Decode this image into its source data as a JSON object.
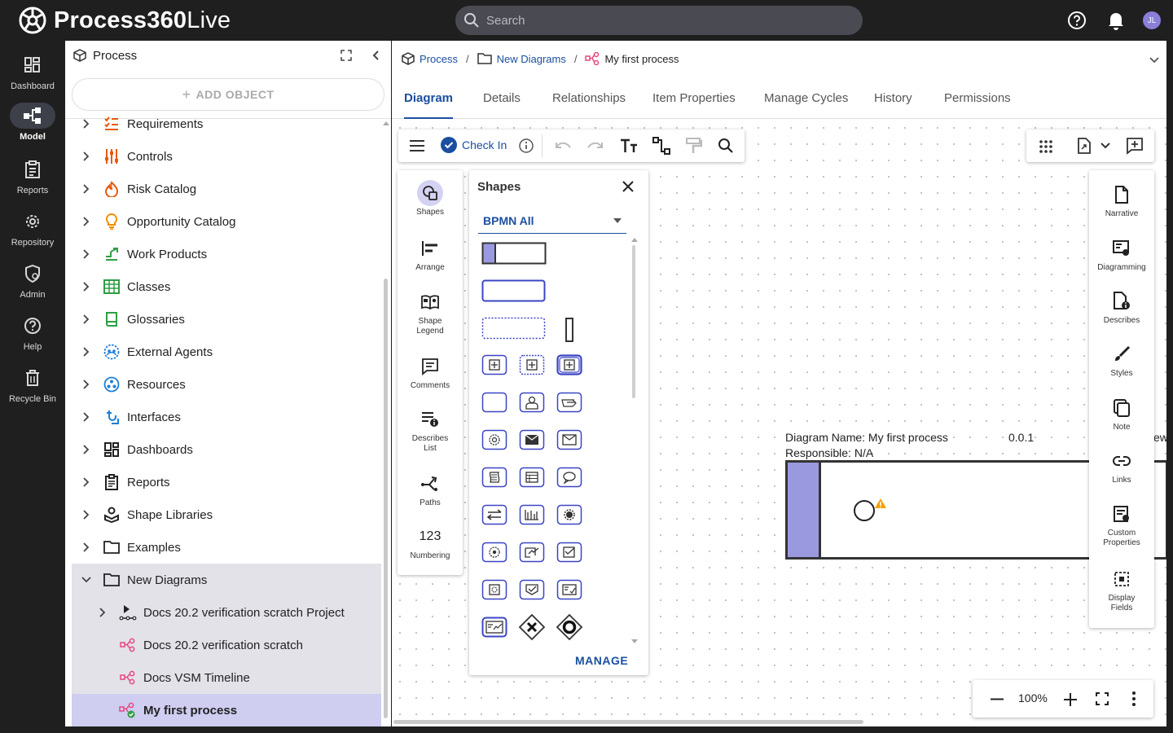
{
  "app": {
    "brand_bold": "Process360",
    "brand_light": "Live"
  },
  "search": {
    "placeholder": "Search"
  },
  "user": {
    "initials": "JL"
  },
  "nav": {
    "items": [
      {
        "label": "Dashboard",
        "icon": "dashboard-icon"
      },
      {
        "label": "Model",
        "icon": "model-icon",
        "active": true
      },
      {
        "label": "Reports",
        "icon": "reports-icon"
      },
      {
        "label": "Repository",
        "icon": "gear-icon"
      },
      {
        "label": "Admin",
        "icon": "admin-icon"
      },
      {
        "label": "Help",
        "icon": "help-icon"
      },
      {
        "label": "Recycle Bin",
        "icon": "trash-icon"
      }
    ]
  },
  "tree": {
    "title": "Process",
    "add_label": "ADD OBJECT",
    "items": [
      {
        "label": "Requirements",
        "icon": "requirements-icon",
        "color": "#e8590c"
      },
      {
        "label": "Controls",
        "icon": "controls-icon",
        "color": "#e8590c"
      },
      {
        "label": "Risk Catalog",
        "icon": "risk-icon",
        "color": "#e8590c"
      },
      {
        "label": "Opportunity Catalog",
        "icon": "lightbulb-icon",
        "color": "#f08c00"
      },
      {
        "label": "Work Products",
        "icon": "work-products-icon",
        "color": "#2f9e44"
      },
      {
        "label": "Classes",
        "icon": "classes-icon",
        "color": "#2f9e44"
      },
      {
        "label": "Glossaries",
        "icon": "book-icon",
        "color": "#2f9e44"
      },
      {
        "label": "External Agents",
        "icon": "external-agents-icon",
        "color": "#1c7ed6"
      },
      {
        "label": "Resources",
        "icon": "resources-icon",
        "color": "#1c7ed6"
      },
      {
        "label": "Interfaces",
        "icon": "interfaces-icon",
        "color": "#1c7ed6"
      },
      {
        "label": "Dashboards",
        "icon": "dashboard-icon",
        "color": "#222"
      },
      {
        "label": "Reports",
        "icon": "reports-icon",
        "color": "#222"
      },
      {
        "label": "Shape Libraries",
        "icon": "shape-libraries-icon",
        "color": "#222"
      },
      {
        "label": "Examples",
        "icon": "folder-icon",
        "color": "#222"
      },
      {
        "label": "New Diagrams",
        "icon": "folder-icon",
        "color": "#222",
        "expanded": true
      },
      {
        "label": "Docs 20.2 verification scratch Project",
        "icon": "project-icon",
        "color": "#222"
      },
      {
        "label": "Docs 20.2 verification scratch",
        "icon": "diagram-icon",
        "color": "#e64980"
      },
      {
        "label": "Docs VSM Timeline",
        "icon": "diagram-icon",
        "color": "#e64980"
      },
      {
        "label": "My first process",
        "icon": "diagram-checked-icon",
        "color": "#e64980"
      }
    ]
  },
  "breadcrumb": {
    "root": "Process",
    "folder": "New Diagrams",
    "current": "My first process"
  },
  "tabs": [
    "Diagram",
    "Details",
    "Relationships",
    "Item Properties",
    "Manage Cycles",
    "History",
    "Permissions"
  ],
  "toolbar": {
    "checkin_label": "Check In"
  },
  "left_panel": {
    "items": [
      {
        "label": "Shapes",
        "icon": "shapes-icon"
      },
      {
        "label": "Arrange",
        "icon": "arrange-icon"
      },
      {
        "label": "Shape Legend",
        "icon": "shape-legend-icon"
      },
      {
        "label": "Comments",
        "icon": "comments-icon"
      },
      {
        "label": "Describes List",
        "icon": "describes-list-icon"
      },
      {
        "label": "Paths",
        "icon": "paths-icon"
      },
      {
        "label": "Numbering",
        "icon": "numbering-icon",
        "glyph": "123"
      }
    ]
  },
  "shapes_panel": {
    "title": "Shapes",
    "library": "BPMN All",
    "manage_label": "MANAGE"
  },
  "right_panel": {
    "items": [
      {
        "label": "Narrative",
        "icon": "narrative-icon"
      },
      {
        "label": "Diagramming",
        "icon": "diagramming-icon"
      },
      {
        "label": "Describes",
        "icon": "describes-icon"
      },
      {
        "label": "Styles",
        "icon": "brush-icon"
      },
      {
        "label": "Note",
        "icon": "note-icon"
      },
      {
        "label": "Links",
        "icon": "link-icon"
      },
      {
        "label": "Custom Properties",
        "icon": "custom-properties-icon"
      },
      {
        "label": "Display Fields",
        "icon": "display-fields-icon"
      }
    ]
  },
  "diagram": {
    "name_line": "Diagram Name: My first process",
    "responsible_line": "Responsible: N/A",
    "version": "0.0.1",
    "clipped_text": "ew"
  },
  "zoom": {
    "value": "100%"
  },
  "colors": {
    "accent": "#1a4fa0",
    "pool_header": "#9a99e0",
    "selection": "#cfcdf0"
  }
}
